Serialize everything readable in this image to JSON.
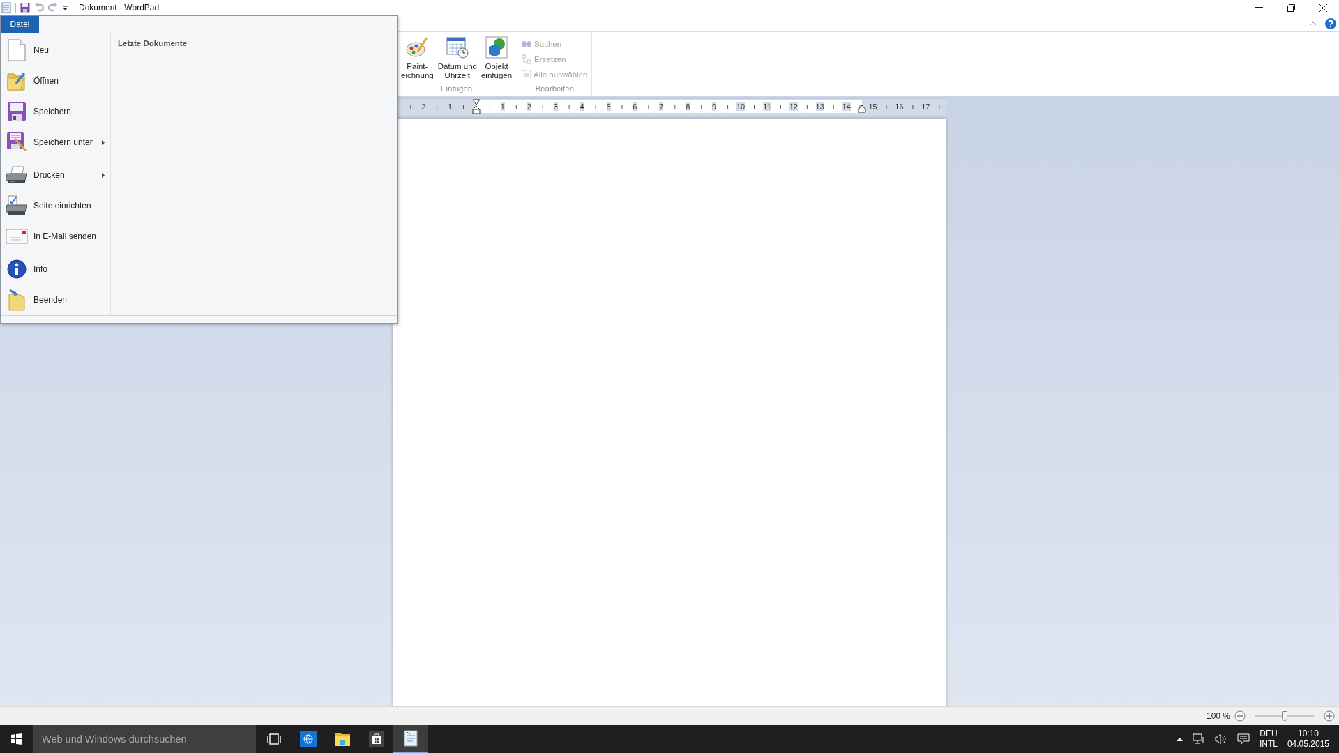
{
  "window": {
    "title": "Dokument - WordPad"
  },
  "file_menu": {
    "tab": "Datei",
    "recent_header": "Letzte Dokumente",
    "items": [
      {
        "label": "Neu",
        "kind": "new",
        "submenu": false,
        "group_start": false
      },
      {
        "label": "Öffnen",
        "kind": "open",
        "submenu": false,
        "group_start": false
      },
      {
        "label": "Speichern",
        "kind": "save",
        "submenu": false,
        "group_start": false
      },
      {
        "label": "Speichern unter",
        "kind": "saveas",
        "submenu": true,
        "group_start": false
      },
      {
        "label": "Drucken",
        "kind": "print",
        "submenu": true,
        "group_start": true
      },
      {
        "label": "Seite einrichten",
        "kind": "pagesetup",
        "submenu": false,
        "group_start": false
      },
      {
        "label": "In E-Mail senden",
        "kind": "email",
        "submenu": false,
        "group_start": false
      },
      {
        "label": "Info",
        "kind": "info",
        "submenu": false,
        "group_start": true
      },
      {
        "label": "Beenden",
        "kind": "exit",
        "submenu": false,
        "group_start": false
      }
    ]
  },
  "ribbon": {
    "groups": [
      {
        "title": "Einfügen",
        "kind": "large",
        "buttons": [
          {
            "label": "Paint-\neichnung",
            "kind": "paint",
            "disabled": false
          },
          {
            "label": "Datum und\nUhrzeit",
            "kind": "calendar",
            "disabled": false
          },
          {
            "label": "Objekt\neinfügen",
            "kind": "object",
            "disabled": false
          }
        ]
      },
      {
        "title": "Bearbeiten",
        "kind": "small",
        "buttons": [
          {
            "label": "Suchen",
            "kind": "binoculars",
            "disabled": true
          },
          {
            "label": "Ersetzen",
            "kind": "replace",
            "disabled": true
          },
          {
            "label": "Alle auswählen",
            "kind": "selectall",
            "disabled": true
          }
        ]
      }
    ]
  },
  "ruler": {
    "left_labels": [
      "2",
      "1"
    ],
    "right_labels": [
      "1",
      "2",
      "3",
      "4",
      "5",
      "6",
      "7",
      "8",
      "9",
      "10",
      "11",
      "12",
      "13",
      "14",
      "15",
      "16",
      "17"
    ]
  },
  "status_bar": {
    "zoom": "100 %",
    "zoom_slider": {
      "level": 0.5
    }
  },
  "taskbar": {
    "search": {
      "placeholder": "Web und Windows durchsuchen"
    },
    "apps": [
      {
        "kind": "task-view",
        "selected": false
      },
      {
        "kind": "browser",
        "selected": false
      },
      {
        "kind": "explorer",
        "selected": false
      },
      {
        "kind": "store",
        "selected": false
      },
      {
        "kind": "wordpad",
        "selected": true
      }
    ],
    "tray": {
      "language": "DEU",
      "layout": "INTL",
      "time": "10:10",
      "date": "04.05.2015"
    }
  }
}
